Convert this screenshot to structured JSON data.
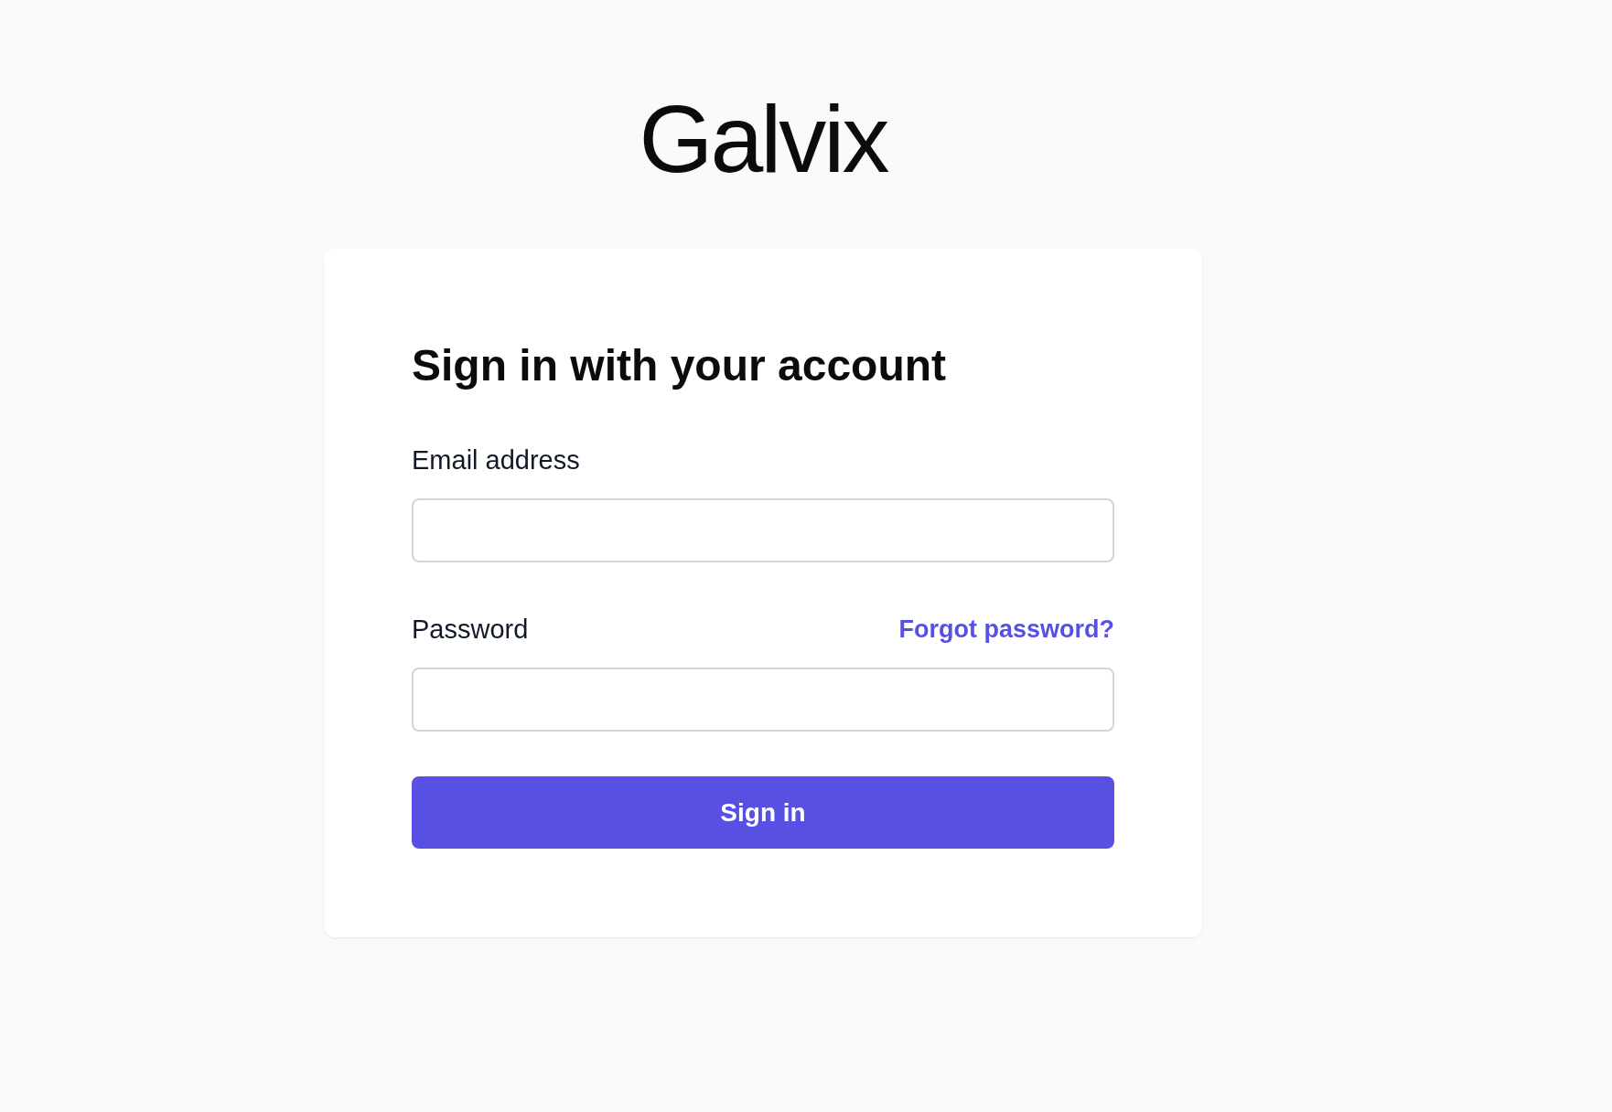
{
  "logo": {
    "text": "Galvix"
  },
  "form": {
    "title": "Sign in with your account",
    "fields": [
      {
        "label": "Email address"
      },
      {
        "label": "Password",
        "link": "Forgot password?"
      }
    ],
    "submit": "Sign in"
  }
}
